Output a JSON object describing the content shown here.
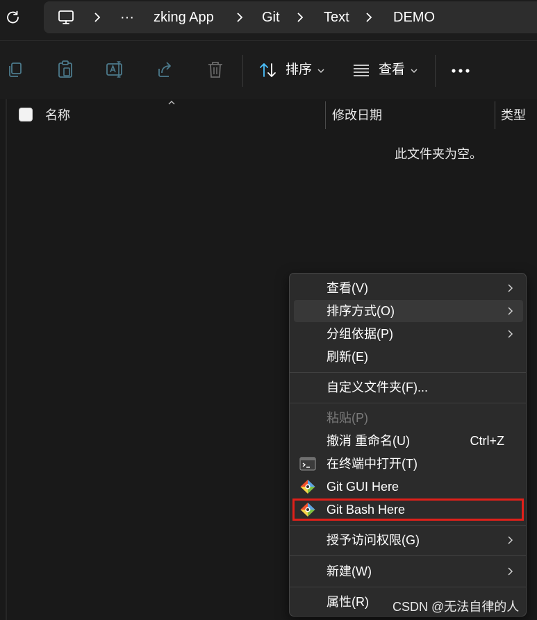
{
  "breadcrumb": {
    "more": "···",
    "items": [
      "zking App",
      "Git",
      "Text",
      "DEMO"
    ]
  },
  "toolbar": {
    "sort_label": "排序",
    "view_label": "查看",
    "more": "···"
  },
  "columns": {
    "name": "名称",
    "modified": "修改日期",
    "type": "类型"
  },
  "empty_message": "此文件夹为空。",
  "context_menu": {
    "items": [
      {
        "label": "查看(V)",
        "submenu": true
      },
      {
        "label": "排序方式(O)",
        "submenu": true
      },
      {
        "label": "分组依据(P)",
        "submenu": true
      },
      {
        "label": "刷新(E)"
      },
      {
        "label": "自定义文件夹(F)..."
      },
      {
        "label": "粘贴(P)",
        "disabled": true
      },
      {
        "label": "撤消 重命名(U)",
        "shortcut": "Ctrl+Z"
      },
      {
        "label": "在终端中打开(T)",
        "icon": "terminal-icon"
      },
      {
        "label": "Git GUI Here",
        "icon": "git-icon"
      },
      {
        "label": "Git Bash Here",
        "icon": "git-icon"
      },
      {
        "label": "授予访问权限(G)",
        "submenu": true
      },
      {
        "label": "新建(W)",
        "submenu": true
      },
      {
        "label": "属性(R)"
      }
    ]
  },
  "watermark": "CSDN @无法自律的人",
  "colors": {
    "background": "#191919",
    "menu_background": "#2b2b2b",
    "highlight_border": "#e0201a",
    "toolbar_accent": "#4cc2ff"
  }
}
